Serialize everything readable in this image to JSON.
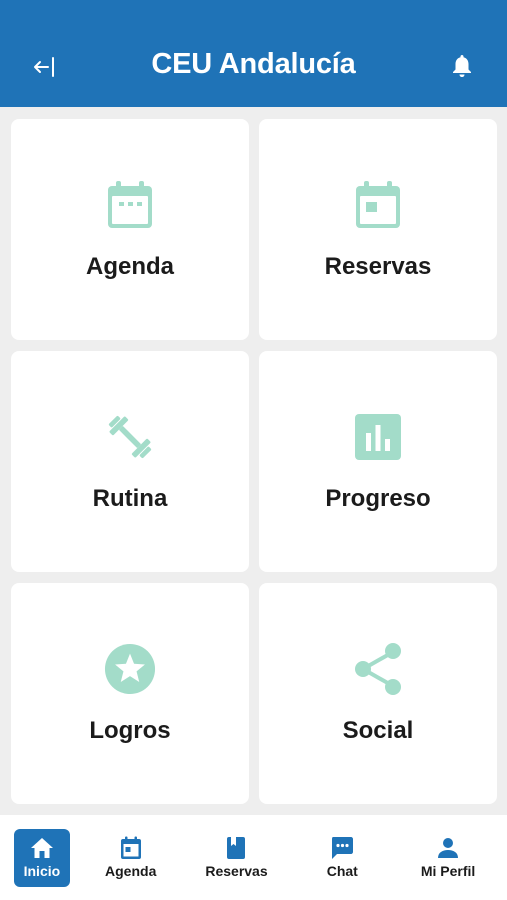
{
  "header": {
    "title": "CEU Andalucía",
    "back_icon": "back-arrow-icon",
    "notification_icon": "bell-icon",
    "background_color": "#1f73b7"
  },
  "tiles": [
    {
      "label": "Agenda",
      "icon": "calendar-icon"
    },
    {
      "label": "Reservas",
      "icon": "calendar-booking-icon"
    },
    {
      "label": "Rutina",
      "icon": "dumbbell-icon"
    },
    {
      "label": "Progreso",
      "icon": "bar-chart-icon"
    },
    {
      "label": "Logros",
      "icon": "star-badge-icon"
    },
    {
      "label": "Social",
      "icon": "share-icon"
    }
  ],
  "tile_icon_color": "#a3dcc9",
  "bottom_nav": [
    {
      "label": "Inicio",
      "icon": "home-icon",
      "active": true
    },
    {
      "label": "Agenda",
      "icon": "calendar-icon",
      "active": false
    },
    {
      "label": "Reservas",
      "icon": "book-icon",
      "active": false
    },
    {
      "label": "Chat",
      "icon": "chat-icon",
      "active": false
    },
    {
      "label": "Mi Perfil",
      "icon": "person-icon",
      "active": false
    }
  ],
  "accent_color": "#1f73b7"
}
